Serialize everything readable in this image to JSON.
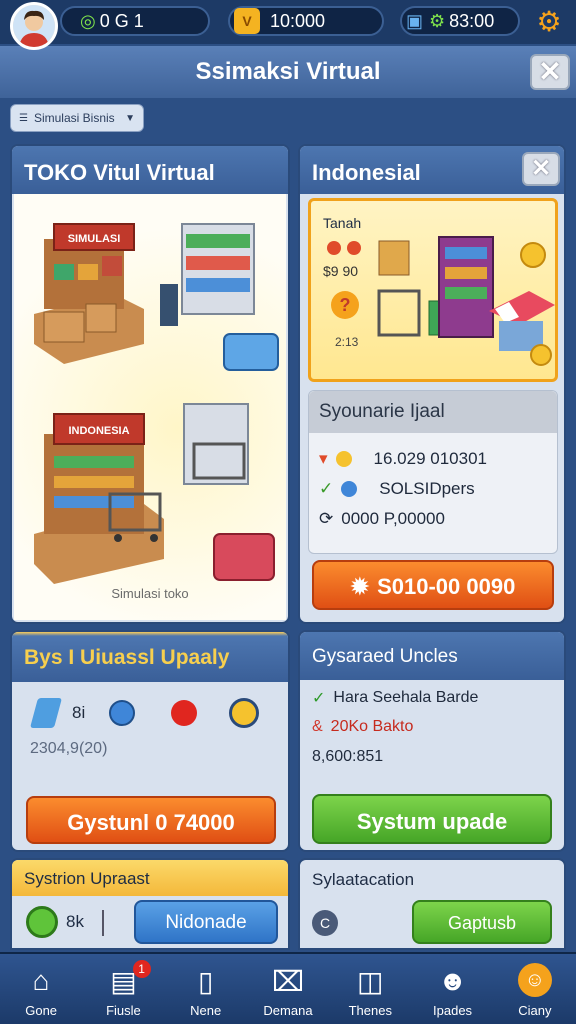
{
  "topbar": {
    "gems": "0 G 1",
    "coins": "10:000",
    "timer": "83:00"
  },
  "title": "Ssimaksi Virtual",
  "filter": {
    "label": "Simulasi Bisnis"
  },
  "left_panel": {
    "title": "TOKO Vitul Virtual",
    "shop_sign_top": "SIMULASI",
    "shop_sign_bottom": "INDONESIA",
    "caption": "Simulasi toko"
  },
  "right_panel": {
    "title": "Indonesial",
    "card_label": "Tanah",
    "card_price": "$9 90",
    "card_small": "2:13",
    "stats_title": "Syounarie Ijaal",
    "stat1": "16.029 010301",
    "stat2": "SOLSIDpers",
    "stat3": "0000 P,00000",
    "action_button": "S010-00 0090"
  },
  "bottom_left": {
    "title": "Bys I Uiuassl Upaaly",
    "level_label": "8i",
    "value": "2304,9(20)",
    "button": "Gystunl 0 74000"
  },
  "bottom_right": {
    "title": "Gysaraed Uncles",
    "line1": "Hara Seehala Barde",
    "line2": "20Ko Bakto",
    "line3": "8,600:851",
    "button": "Systum upade"
  },
  "bottom_left2": {
    "title": "Systrion Upraast",
    "value": "8k",
    "button": "Nidonade"
  },
  "bottom_right2": {
    "title": "Sylaatacation",
    "button": "Gaptusb"
  },
  "nav": [
    {
      "label": "Gone"
    },
    {
      "label": "Fiusle",
      "badge": "1"
    },
    {
      "label": "Nene"
    },
    {
      "label": "Demana"
    },
    {
      "label": "Thenes"
    },
    {
      "label": "Ipades"
    },
    {
      "label": "Ciany"
    }
  ],
  "colors": {
    "accent": "#f5a21c",
    "panel_header": "#4d76b0",
    "bg": "#2c4f84"
  }
}
